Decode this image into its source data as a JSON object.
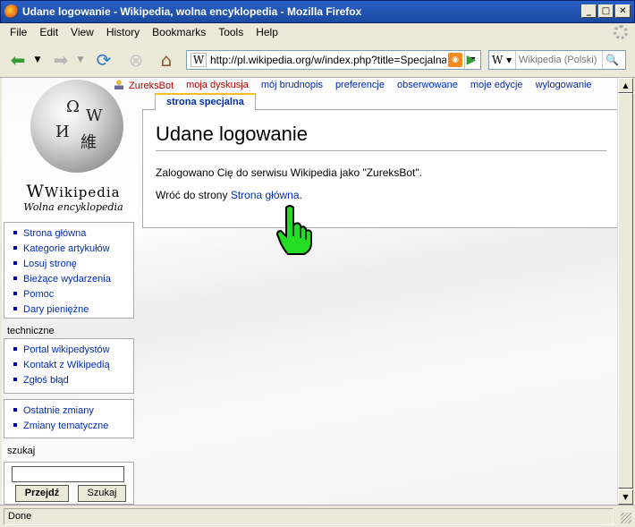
{
  "window": {
    "title": "Udane logowanie - Wikipedia, wolna encyklopedia - Mozilla Firefox"
  },
  "menu": [
    "File",
    "Edit",
    "View",
    "History",
    "Bookmarks",
    "Tools",
    "Help"
  ],
  "toolbar": {
    "url": "http://pl.wikipedia.org/w/index.php?title=Specjalna",
    "url_favicon": "W",
    "search_engine": "W",
    "search_placeholder": "Wikipedia (Polski)"
  },
  "wiki": {
    "logo_name": "Wikipedia",
    "logo_tagline": "Wolna encyklopedia",
    "personal": {
      "user": "ZureksBot",
      "talk": "moja dyskusja",
      "sandbox": "mój brudnopis",
      "prefs": "preferencje",
      "watchlist": "obserwowane",
      "contribs": "moje edycje",
      "logout": "wylogowanie"
    },
    "tab": "strona specjalna",
    "heading": "Udane logowanie",
    "message": "Zalogowano Cię do serwisu Wikipedia jako \"ZureksBot\".",
    "return_prefix": "Wróć do strony ",
    "return_link": "Strona główna",
    "return_suffix": ".",
    "nav": [
      "Strona główna",
      "Kategorie artykułów",
      "Losuj stronę",
      "Bieżące wydarzenia",
      "Pomoc",
      "Dary pieniężne"
    ],
    "tech_label": "techniczne",
    "tech": [
      "Portal wikipedystów",
      "Kontakt z Wikipedią",
      "Zgłoś błąd"
    ],
    "changes": [
      "Ostatnie zmiany",
      "Zmiany tematyczne"
    ],
    "search_label": "szukaj",
    "search_go": "Przejdź",
    "search_btn": "Szukaj"
  },
  "status": {
    "text": "Done"
  },
  "colors": {
    "link": "#002bb8",
    "redlink": "#ba0000",
    "tab_accent": "#fabd23"
  }
}
